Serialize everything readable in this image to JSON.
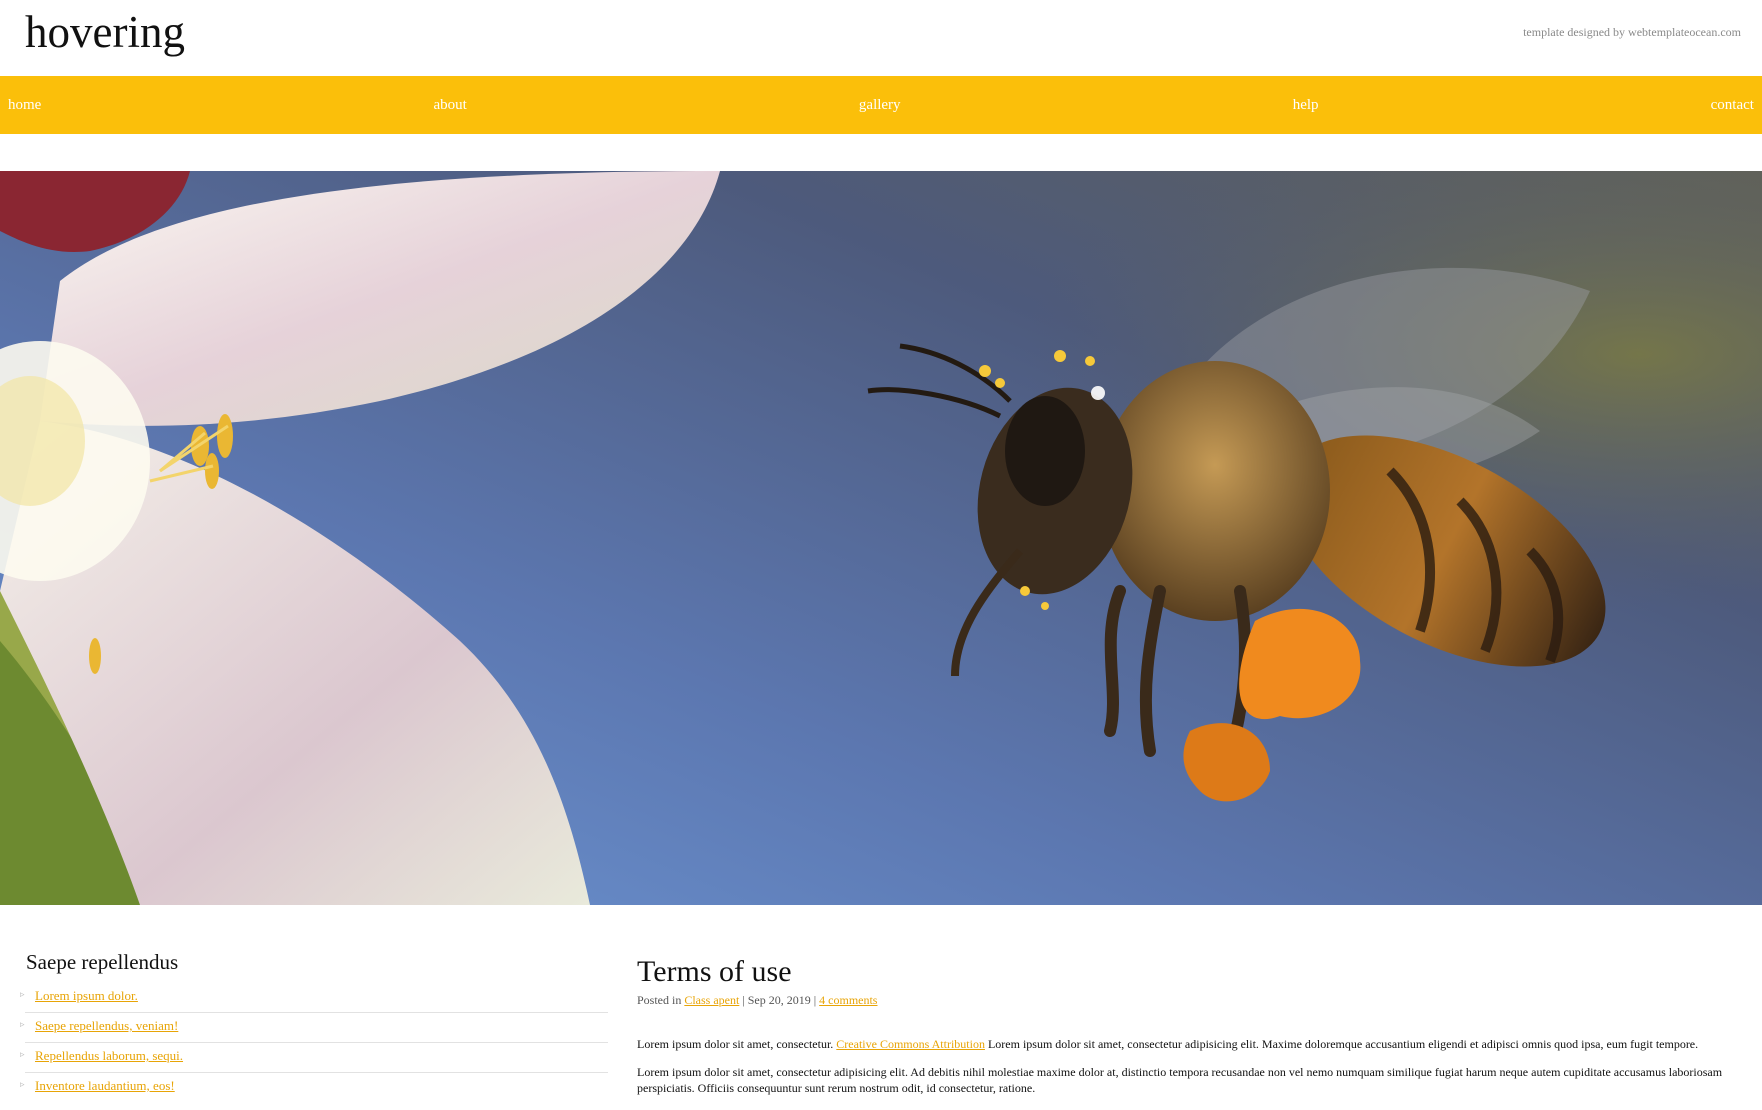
{
  "site": {
    "title": "hovering",
    "credit": "template designed by webtemplateocean.com"
  },
  "nav": {
    "items": [
      "home",
      "about",
      "gallery",
      "help",
      "contact"
    ]
  },
  "colors": {
    "accent": "#fbbf0a",
    "link": "#e8a406"
  },
  "hero": {
    "icon": "bee-photo"
  },
  "sidebar": {
    "title": "Saepe repellendus",
    "links": [
      "Lorem ipsum dolor.",
      "Saepe repellendus, veniam!",
      "Repellendus laborum, sequi.",
      "Inventore laudantium, eos!"
    ]
  },
  "article": {
    "title": "Terms of use",
    "meta": {
      "posted_in": "Posted in",
      "category": "Class apent",
      "separator1": " | Sep 20, 2019 | ",
      "comments": "4 comments"
    },
    "p1": {
      "before": "Lorem ipsum dolor sit amet, consectetur. ",
      "link": "Creative Commons Attribution",
      "after": " Lorem ipsum dolor sit amet, consectetur adipisicing elit. Maxime doloremque accusantium eligendi et adipisci omnis quod ipsa, eum fugit tempore."
    },
    "p2": "Lorem ipsum dolor sit amet, consectetur adipisicing elit. Ad debitis nihil molestiae maxime dolor at, distinctio tempora recusandae non vel nemo numquam similique fugiat harum neque autem cupiditate accusamus laboriosam perspiciatis. Officiis consequuntur sunt rerum nostrum odit, id consectetur, ratione."
  }
}
